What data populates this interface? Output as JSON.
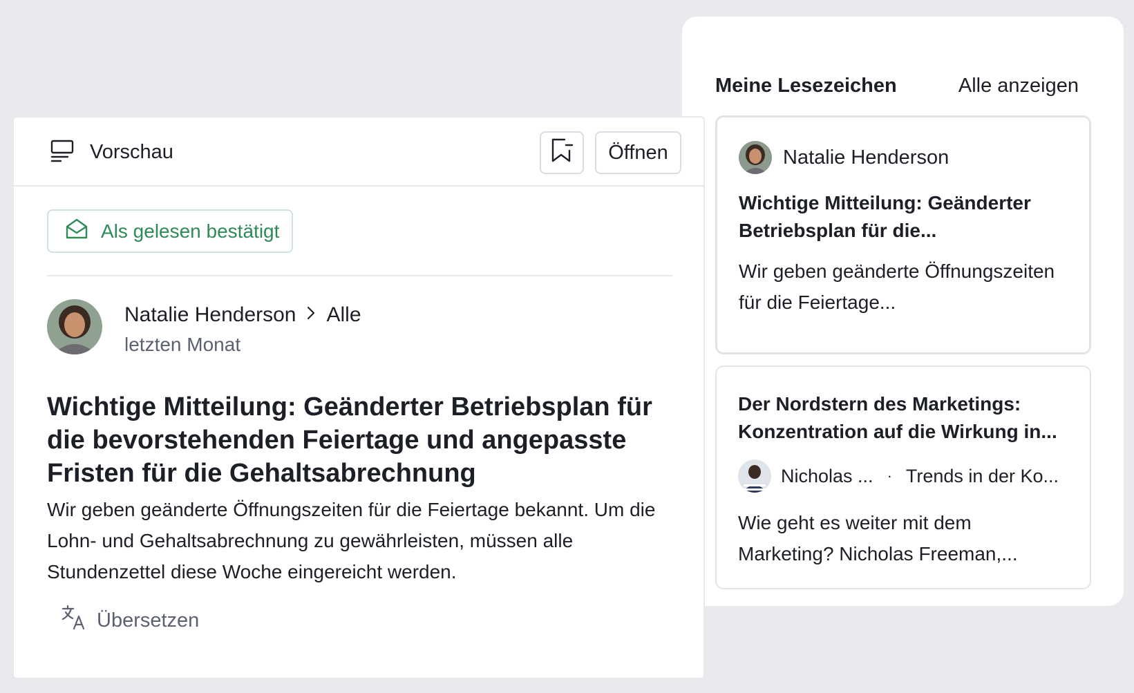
{
  "bookmarks": {
    "title": "Meine Lesezeichen",
    "show_all": "Alle anzeigen",
    "cards": [
      {
        "author": "Natalie Henderson",
        "title": "Wichtige Mitteilung: Geänderter Betriebsplan für die...",
        "excerpt": "Wir geben geänderte Öffnungszeiten für die Feiertage..."
      },
      {
        "title": "Der Nordstern des Marketings: Konzentration auf die Wirkung in...",
        "author": "Nicholas ...",
        "separator": "·",
        "channel": "Trends in der Ko...",
        "excerpt": "Wie geht es weiter mit dem Marketing? Nicholas Freeman,..."
      }
    ]
  },
  "preview": {
    "label": "Vorschau",
    "open_button": "Öffnen",
    "read_confirmation": "Als gelesen bestätigt",
    "author": "Natalie Henderson",
    "channel": "Alle",
    "time": "letzten Monat",
    "title": "Wichtige Mitteilung: Geänderter Betriebsplan für die bevorstehenden Feiertage und angepasste Fristen für die Gehaltsabrechnung",
    "body": "Wir geben geänderte Öffnungszeiten für die Feiertage bekannt. Um die Lohn- und Gehaltsabrechnung zu gewährleisten, müssen alle Stundenzettel diese Woche eingereicht werden.",
    "translate": "Übersetzen"
  },
  "icons": {
    "preview": "monitor-icon",
    "bookmark": "bookmark-icon",
    "read": "envelope-open-icon",
    "chevron": "chevron-right-icon",
    "translate": "translate-icon"
  },
  "colors": {
    "background": "#e9eaee",
    "accent_green": "#2e8a57",
    "text": "#1c1f26",
    "muted": "#5b6170"
  }
}
